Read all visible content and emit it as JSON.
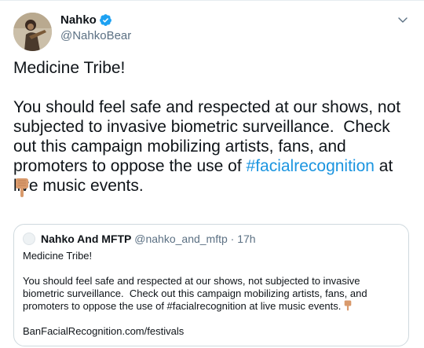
{
  "tweet": {
    "author": {
      "display_name": "Nahko",
      "handle": "@NahkoBear",
      "verified": true
    },
    "text_intro": "Medicine Tribe!",
    "text_main": "You should feel safe and respected at our shows, not subjected to invasive biometric surveillance.  Check out this campaign mobilizing artists, fans, and promoters to oppose the use of ",
    "hashtag": "#facialrecognition",
    "text_after_hashtag": " at live music events.",
    "emoji": "backhand-index-pointing-down"
  },
  "quoted_tweet": {
    "author_name": "Nahko And MFTP",
    "author_handle": "@nahko_and_mftp",
    "separator": " · ",
    "time": "17h",
    "text_intro": "Medicine Tribe!",
    "text_main": "You should feel safe and respected at our shows, not subjected to invasive biometric surveillance.  Check out this campaign mobilizing artists, fans, and promoters to oppose the use of #facialrecognition at live music events.",
    "link": "BanFacialRecognition.com/festivals"
  },
  "colors": {
    "link_blue": "#1b95e0",
    "verified_blue": "#1da1f2",
    "muted_text": "#5b7083",
    "border": "#cfd9de"
  }
}
